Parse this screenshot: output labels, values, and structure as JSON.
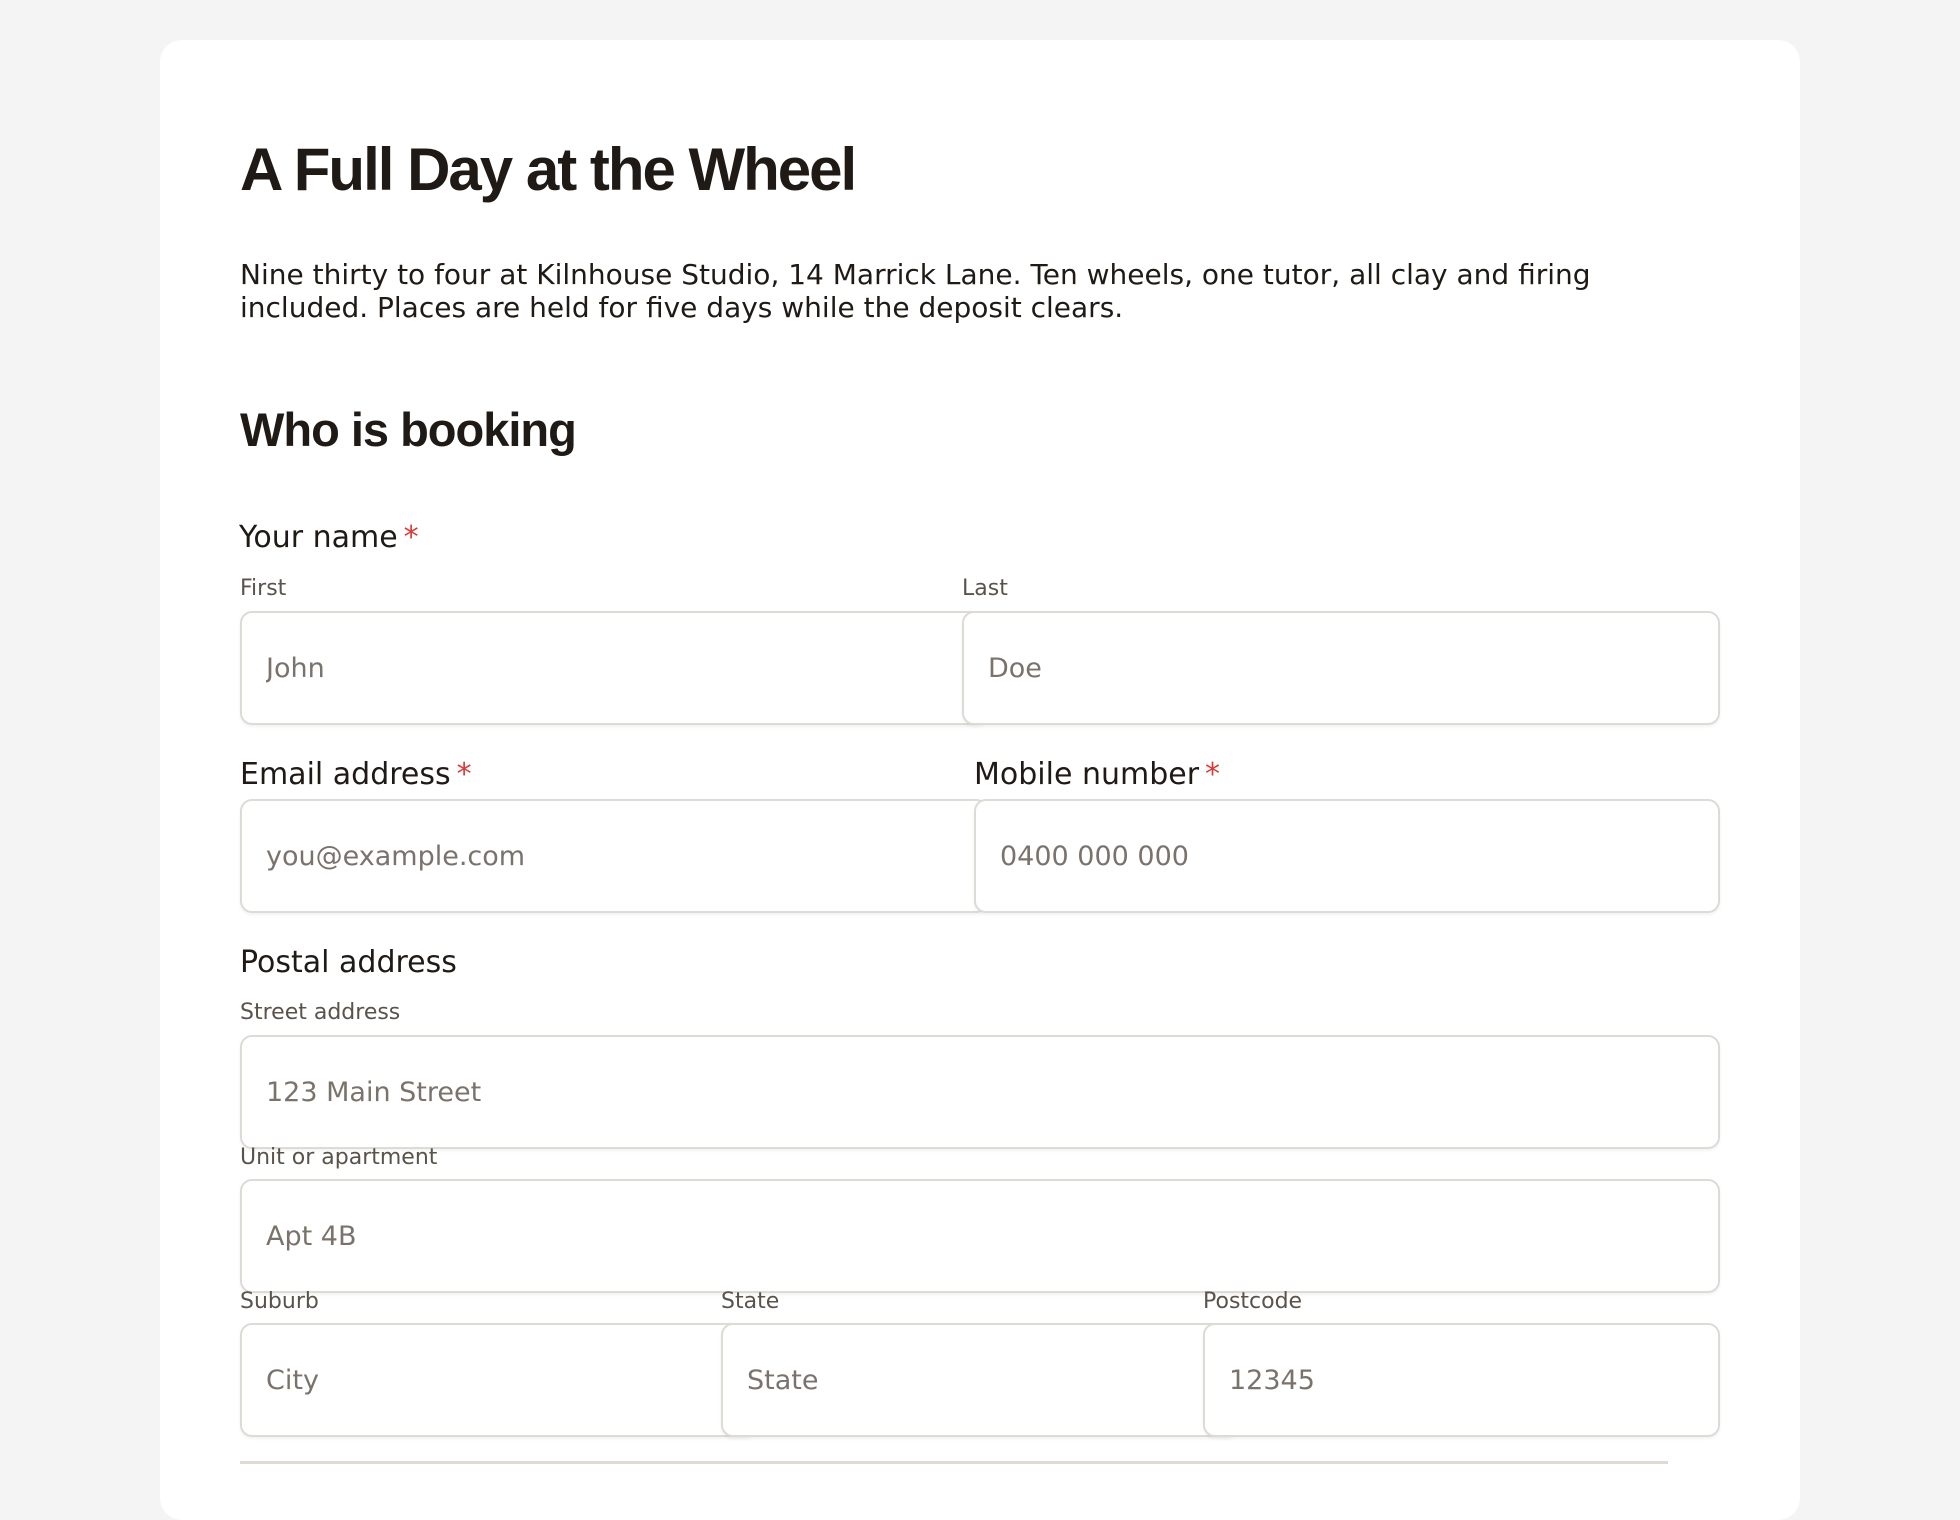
{
  "page": {
    "title": "A Full Day at the Wheel",
    "intro": "Nine thirty to four at Kilnhouse Studio, 14 Marrick Lane. Ten wheels, one tutor, all clay and firing included. Places are held for five days while the deposit clears."
  },
  "section": {
    "title": "Who is booking"
  },
  "name": {
    "label": "Your name",
    "required_mark": "*",
    "first": {
      "label": "First",
      "placeholder": "John",
      "value": ""
    },
    "last": {
      "label": "Last",
      "placeholder": "Doe",
      "value": ""
    }
  },
  "email": {
    "label": "Email address",
    "required_mark": "*",
    "placeholder": "you@example.com",
    "value": ""
  },
  "mobile": {
    "label": "Mobile number",
    "required_mark": "*",
    "placeholder": "0400 000 000",
    "value": ""
  },
  "address": {
    "label": "Postal address",
    "street": {
      "label": "Street address",
      "placeholder": "123 Main Street",
      "value": ""
    },
    "unit": {
      "label": "Unit or apartment",
      "placeholder": "Apt 4B",
      "value": ""
    },
    "suburb": {
      "label": "Suburb",
      "placeholder": "City",
      "value": ""
    },
    "state": {
      "label": "State",
      "placeholder": "State",
      "value": ""
    },
    "postcode": {
      "label": "Postcode",
      "placeholder": "12345",
      "value": ""
    }
  },
  "colors": {
    "background": "#f4f4f4",
    "card": "#ffffff",
    "text": "#1f1a15",
    "muted_text": "#5a534c",
    "placeholder": "#7a736c",
    "required": "#d93a36",
    "border": "#dedad6"
  }
}
